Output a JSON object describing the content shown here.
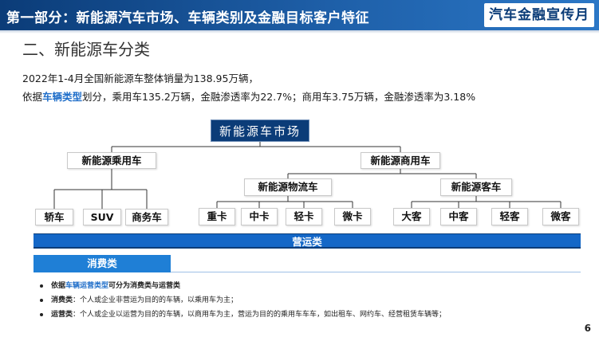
{
  "header": {
    "title": "第一部分：新能源汽车市场、车辆类别及金融目标客户特征",
    "brand": "汽车金融宣传月"
  },
  "section_title": "二、新能源车分类",
  "summary": {
    "line1": "2022年1-4月全国新能源车整体销量为138.95万辆，",
    "line2_prefix": "依据",
    "line2_highlight": "车辆类型",
    "line2_suffix": "划分，乘用车135.2万辆，金融渗透率为22.7%；商用车3.75万辆，金融渗透率为3.18%"
  },
  "tree": {
    "root": "新能源车市场",
    "passenger": {
      "label": "新能源乘用车",
      "children": [
        "轿车",
        "SUV",
        "商务车"
      ]
    },
    "commercial": {
      "label": "新能源商用车",
      "logistics": {
        "label": "新能源物流车",
        "children": [
          "重卡",
          "中卡",
          "轻卡",
          "微卡"
        ]
      },
      "bus": {
        "label": "新能源客车",
        "children": [
          "大客",
          "中客",
          "轻客",
          "微客"
        ]
      }
    }
  },
  "bars": {
    "operating": "营运类",
    "consumer": "消费类"
  },
  "notes": [
    {
      "prefix": "依据",
      "highlight": "车辆运营类型",
      "suffix": "可分为消费类与运营类"
    },
    {
      "term": "消费类",
      "text": "：个人或企业非营运为目的的车辆，以乘用车为主；"
    },
    {
      "term": "运营类",
      "text": "：个人或企业以运营为目的的车辆，以商用车为主，营运为目的的乘用车车车，如出租车、网约车、经营租赁车辆等；"
    }
  ],
  "page_number": "6",
  "colors": {
    "header_dark": "#0b3c78",
    "accent_blue": "#1f6ec9",
    "operating_bar": "#1467c7",
    "consumer_bar": "#1f7fd6"
  }
}
